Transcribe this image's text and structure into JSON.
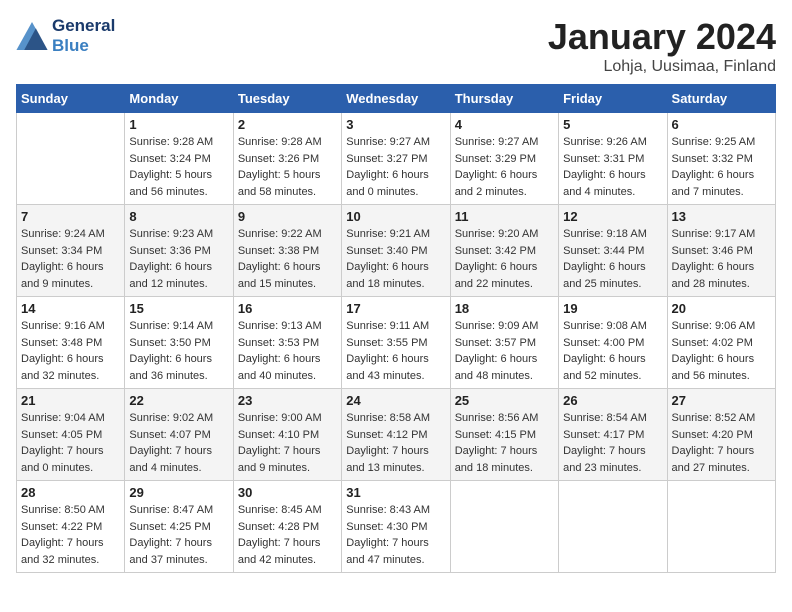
{
  "header": {
    "logo_line1": "General",
    "logo_line2": "Blue",
    "title": "January 2024",
    "subtitle": "Lohja, Uusimaa, Finland"
  },
  "weekdays": [
    "Sunday",
    "Monday",
    "Tuesday",
    "Wednesday",
    "Thursday",
    "Friday",
    "Saturday"
  ],
  "weeks": [
    [
      {
        "day": "",
        "detail": ""
      },
      {
        "day": "1",
        "detail": "Sunrise: 9:28 AM\nSunset: 3:24 PM\nDaylight: 5 hours\nand 56 minutes."
      },
      {
        "day": "2",
        "detail": "Sunrise: 9:28 AM\nSunset: 3:26 PM\nDaylight: 5 hours\nand 58 minutes."
      },
      {
        "day": "3",
        "detail": "Sunrise: 9:27 AM\nSunset: 3:27 PM\nDaylight: 6 hours\nand 0 minutes."
      },
      {
        "day": "4",
        "detail": "Sunrise: 9:27 AM\nSunset: 3:29 PM\nDaylight: 6 hours\nand 2 minutes."
      },
      {
        "day": "5",
        "detail": "Sunrise: 9:26 AM\nSunset: 3:31 PM\nDaylight: 6 hours\nand 4 minutes."
      },
      {
        "day": "6",
        "detail": "Sunrise: 9:25 AM\nSunset: 3:32 PM\nDaylight: 6 hours\nand 7 minutes."
      }
    ],
    [
      {
        "day": "7",
        "detail": "Sunrise: 9:24 AM\nSunset: 3:34 PM\nDaylight: 6 hours\nand 9 minutes."
      },
      {
        "day": "8",
        "detail": "Sunrise: 9:23 AM\nSunset: 3:36 PM\nDaylight: 6 hours\nand 12 minutes."
      },
      {
        "day": "9",
        "detail": "Sunrise: 9:22 AM\nSunset: 3:38 PM\nDaylight: 6 hours\nand 15 minutes."
      },
      {
        "day": "10",
        "detail": "Sunrise: 9:21 AM\nSunset: 3:40 PM\nDaylight: 6 hours\nand 18 minutes."
      },
      {
        "day": "11",
        "detail": "Sunrise: 9:20 AM\nSunset: 3:42 PM\nDaylight: 6 hours\nand 22 minutes."
      },
      {
        "day": "12",
        "detail": "Sunrise: 9:18 AM\nSunset: 3:44 PM\nDaylight: 6 hours\nand 25 minutes."
      },
      {
        "day": "13",
        "detail": "Sunrise: 9:17 AM\nSunset: 3:46 PM\nDaylight: 6 hours\nand 28 minutes."
      }
    ],
    [
      {
        "day": "14",
        "detail": "Sunrise: 9:16 AM\nSunset: 3:48 PM\nDaylight: 6 hours\nand 32 minutes."
      },
      {
        "day": "15",
        "detail": "Sunrise: 9:14 AM\nSunset: 3:50 PM\nDaylight: 6 hours\nand 36 minutes."
      },
      {
        "day": "16",
        "detail": "Sunrise: 9:13 AM\nSunset: 3:53 PM\nDaylight: 6 hours\nand 40 minutes."
      },
      {
        "day": "17",
        "detail": "Sunrise: 9:11 AM\nSunset: 3:55 PM\nDaylight: 6 hours\nand 43 minutes."
      },
      {
        "day": "18",
        "detail": "Sunrise: 9:09 AM\nSunset: 3:57 PM\nDaylight: 6 hours\nand 48 minutes."
      },
      {
        "day": "19",
        "detail": "Sunrise: 9:08 AM\nSunset: 4:00 PM\nDaylight: 6 hours\nand 52 minutes."
      },
      {
        "day": "20",
        "detail": "Sunrise: 9:06 AM\nSunset: 4:02 PM\nDaylight: 6 hours\nand 56 minutes."
      }
    ],
    [
      {
        "day": "21",
        "detail": "Sunrise: 9:04 AM\nSunset: 4:05 PM\nDaylight: 7 hours\nand 0 minutes."
      },
      {
        "day": "22",
        "detail": "Sunrise: 9:02 AM\nSunset: 4:07 PM\nDaylight: 7 hours\nand 4 minutes."
      },
      {
        "day": "23",
        "detail": "Sunrise: 9:00 AM\nSunset: 4:10 PM\nDaylight: 7 hours\nand 9 minutes."
      },
      {
        "day": "24",
        "detail": "Sunrise: 8:58 AM\nSunset: 4:12 PM\nDaylight: 7 hours\nand 13 minutes."
      },
      {
        "day": "25",
        "detail": "Sunrise: 8:56 AM\nSunset: 4:15 PM\nDaylight: 7 hours\nand 18 minutes."
      },
      {
        "day": "26",
        "detail": "Sunrise: 8:54 AM\nSunset: 4:17 PM\nDaylight: 7 hours\nand 23 minutes."
      },
      {
        "day": "27",
        "detail": "Sunrise: 8:52 AM\nSunset: 4:20 PM\nDaylight: 7 hours\nand 27 minutes."
      }
    ],
    [
      {
        "day": "28",
        "detail": "Sunrise: 8:50 AM\nSunset: 4:22 PM\nDaylight: 7 hours\nand 32 minutes."
      },
      {
        "day": "29",
        "detail": "Sunrise: 8:47 AM\nSunset: 4:25 PM\nDaylight: 7 hours\nand 37 minutes."
      },
      {
        "day": "30",
        "detail": "Sunrise: 8:45 AM\nSunset: 4:28 PM\nDaylight: 7 hours\nand 42 minutes."
      },
      {
        "day": "31",
        "detail": "Sunrise: 8:43 AM\nSunset: 4:30 PM\nDaylight: 7 hours\nand 47 minutes."
      },
      {
        "day": "",
        "detail": ""
      },
      {
        "day": "",
        "detail": ""
      },
      {
        "day": "",
        "detail": ""
      }
    ]
  ]
}
